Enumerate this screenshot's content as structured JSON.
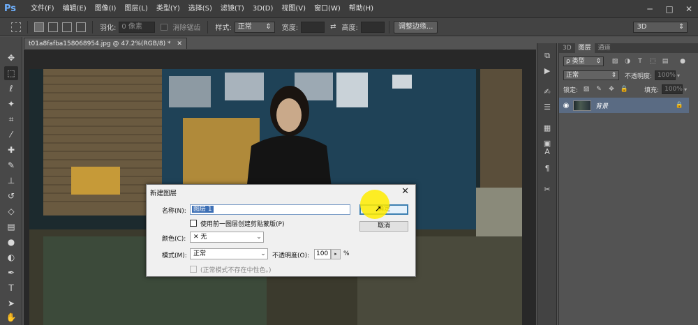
{
  "app": {
    "logo": "Ps",
    "menu": [
      "文件(F)",
      "编辑(E)",
      "图像(I)",
      "图层(L)",
      "类型(Y)",
      "选择(S)",
      "滤镜(T)",
      "3D(D)",
      "视图(V)",
      "窗口(W)",
      "帮助(H)"
    ],
    "window_controls": [
      "─",
      "□",
      "✕"
    ]
  },
  "options_bar": {
    "feather_label": "羽化:",
    "feather_value": "0 像素",
    "antialias_label": "消除锯齿",
    "style_label": "样式:",
    "style_value": "正常",
    "width_label": "宽度:",
    "height_label": "高度:",
    "refine_edge_button": "调整边缘...",
    "workspace_value": "3D"
  },
  "document": {
    "tab_title": "t01a8fafba158068954.jpg @ 47.2%(RGB/8) *",
    "tab_close": "✕"
  },
  "layers_panel": {
    "tabs": [
      "3D",
      "图层",
      "通道"
    ],
    "active_tab": "图层",
    "filter_kind": "ρ 类型",
    "blend_mode": "正常",
    "opacity_label": "不透明度:",
    "opacity_value": "100%",
    "lock_label": "锁定:",
    "fill_label": "填充:",
    "fill_value": "100%",
    "layers": [
      {
        "name": "背景",
        "visible": true,
        "locked": true
      }
    ]
  },
  "dialog": {
    "title": "新建图层",
    "close": "✕",
    "name_label": "名称(N):",
    "name_value": "图层 1",
    "clip_checkbox_label": "使用前一图层创建剪贴蒙版(P)",
    "color_label": "颜色(C):",
    "color_value": "无",
    "color_swatch": "✕",
    "mode_label": "模式(M):",
    "mode_value": "正常",
    "opacity_label": "不透明度(O):",
    "opacity_value": "100",
    "opacity_stepper": "▸",
    "opacity_unit": "%",
    "neutral_label": "(正常模式不存在中性色。)",
    "ok_button": "确定",
    "cancel_button": "取消"
  },
  "colors": {
    "accent_highlight": "#ffec00",
    "selected_layer": "#5a6b83",
    "dialog_bg": "#f0f0f0"
  }
}
